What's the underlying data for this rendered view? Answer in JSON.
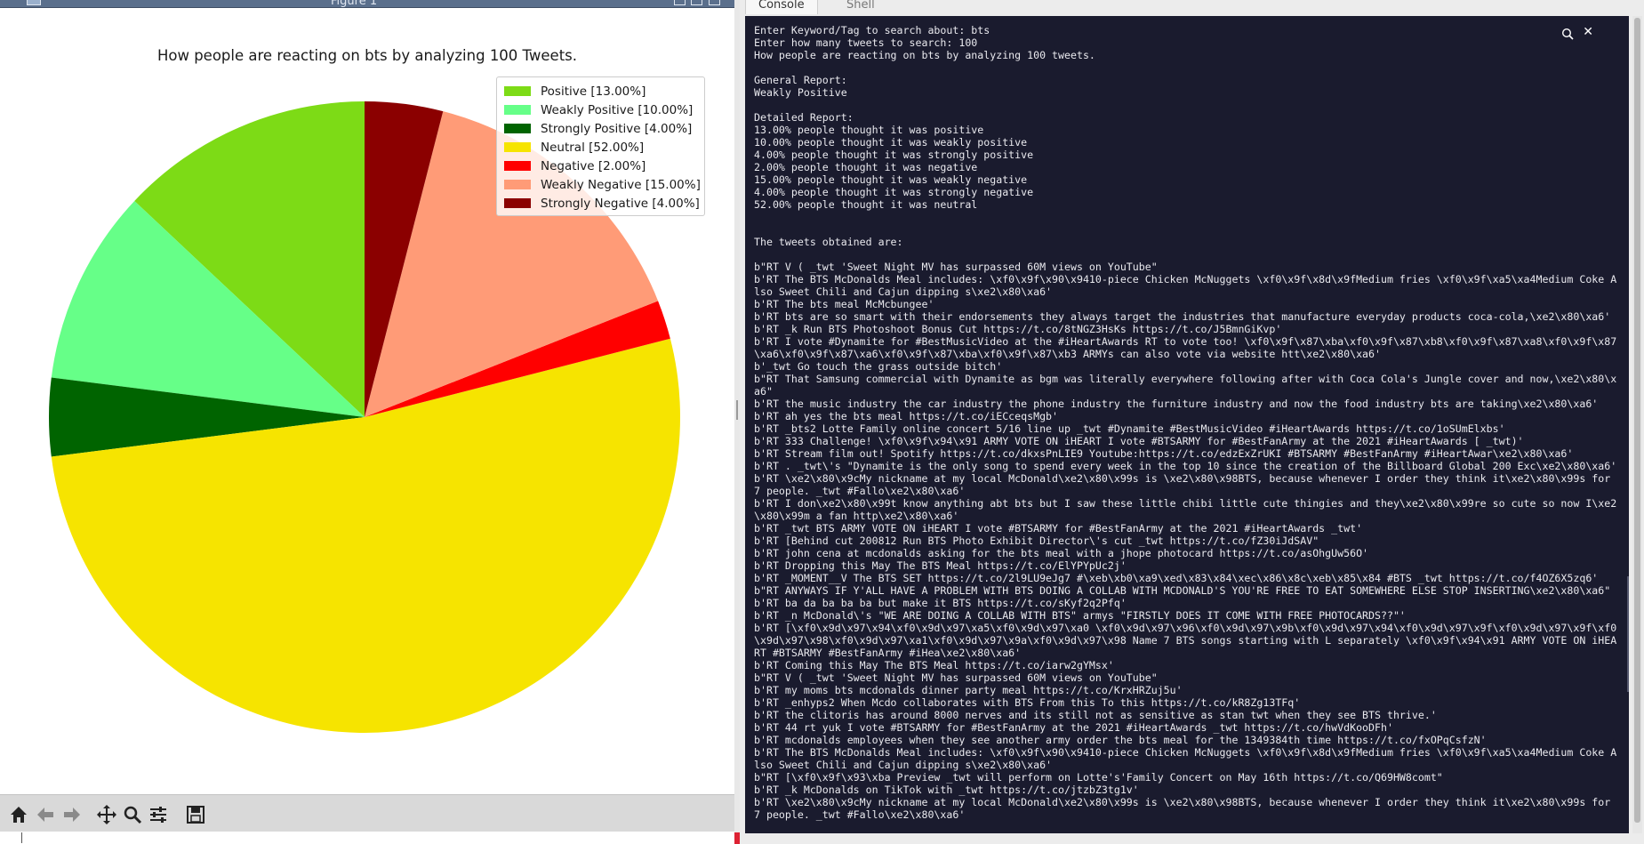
{
  "figure_window": {
    "title": "Figure 1"
  },
  "chart_data": {
    "type": "pie",
    "title": "How people are reacting on bts by analyzing 100 Tweets.",
    "start_angle_deg": 90,
    "direction": "counterclockwise",
    "legend_position": "upper-right",
    "slices": [
      {
        "label": "Positive [13.00%]",
        "value": 13,
        "color": "#7ddb16"
      },
      {
        "label": "Weakly Positive [10.00%]",
        "value": 10,
        "color": "#66ff88"
      },
      {
        "label": "Strongly Positive [4.00%]",
        "value": 4,
        "color": "#006400"
      },
      {
        "label": "Neutral [52.00%]",
        "value": 52,
        "color": "#f6e400"
      },
      {
        "label": "Negative [2.00%]",
        "value": 2,
        "color": "#ff0000"
      },
      {
        "label": "Weakly Negative [15.00%]",
        "value": 15,
        "color": "#ff9b77"
      },
      {
        "label": "Strongly Negative [4.00%]",
        "value": 4,
        "color": "#8b0000"
      }
    ]
  },
  "toolbar": {
    "buttons": [
      "home-icon",
      "back-icon",
      "forward-icon",
      "pan-icon",
      "zoom-icon",
      "configure-subplots-icon",
      "save-icon"
    ]
  },
  "console_pane": {
    "tabs": [
      "Console",
      "Shell"
    ],
    "active_tab": "Console",
    "close_glyph": "✕",
    "lines": [
      "Enter Keyword/Tag to search about: bts",
      "Enter how many tweets to search: 100",
      "How people are reacting on bts by analyzing 100 tweets.",
      "",
      "General Report:",
      "Weakly Positive",
      "",
      "Detailed Report:",
      "13.00% people thought it was positive",
      "10.00% people thought it was weakly positive",
      "4.00% people thought it was strongly positive",
      "2.00% people thought it was negative",
      "15.00% people thought it was weakly negative",
      "4.00% people thought it was strongly negative",
      "52.00% people thought it was neutral",
      "",
      "",
      "The tweets obtained are:",
      "",
      "b\"RT V ( _twt 'Sweet Night MV has surpassed 60M views on YouTube\"",
      "b'RT The BTS McDonalds Meal includes: \\xf0\\x9f\\x90\\x9410-piece Chicken McNuggets \\xf0\\x9f\\x8d\\x9fMedium fries \\xf0\\x9f\\xa5\\xa4Medium Coke Also Sweet Chili and Cajun dipping s\\xe2\\x80\\xa6'",
      "b'RT The bts meal McMcbungee'",
      "b'RT bts are so smart with their endorsements they always target the industries that manufacture everyday products coca-cola,\\xe2\\x80\\xa6'",
      "b'RT _k Run BTS Photoshoot Bonus Cut https://t.co/8tNGZ3HsKs https://t.co/J5BmnGiKvp'",
      "b'RT I vote #Dynamite for #BestMusicVideo at the #iHeartAwards RT to vote too! \\xf0\\x9f\\x87\\xba\\xf0\\x9f\\x87\\xb8\\xf0\\x9f\\x87\\xa8\\xf0\\x9f\\x87\\xa6\\xf0\\x9f\\x87\\xa6\\xf0\\x9f\\x87\\xba\\xf0\\x9f\\x87\\xb3 ARMYs can also vote via website htt\\xe2\\x80\\xa6'",
      "b'_twt Go touch the grass outside bitch'",
      "b\"RT That Samsung commercial with Dynamite as bgm was literally everywhere following after with Coca Cola's Jungle cover and now,\\xe2\\x80\\xa6\"",
      "b'RT the music industry the car industry the phone industry the furniture industry and now the food industry bts are taking\\xe2\\x80\\xa6'",
      "b'RT ah yes the bts meal https://t.co/iECceqsMgb'",
      "b'RT _bts2 Lotte Family online concert 5/16 line up _twt #Dynamite #BestMusicVideo #iHeartAwards https://t.co/1oSUmElxbs'",
      "b'RT 333 Challenge! \\xf0\\x9f\\x94\\x91 ARMY VOTE ON iHEART I vote #BTSARMY for #BestFanArmy at the 2021 #iHeartAwards [ _twt)'",
      "b'RT Stream film out! Spotify https://t.co/dkxsPnLIE9 Youtube:https://t.co/edzExZrUKI #BTSARMY #BestFanArmy #iHeartAwar\\xe2\\x80\\xa6'",
      "b'RT . _twt\\'s \"Dynamite is the only song to spend every week in the top 10 since the creation of the Billboard Global 200 Exc\\xe2\\x80\\xa6'",
      "b'RT \\xe2\\x80\\x9cMy nickname at my local McDonald\\xe2\\x80\\x99s is \\xe2\\x80\\x98BTS, because whenever I order they think it\\xe2\\x80\\x99s for 7 people. _twt #Fallo\\xe2\\x80\\xa6'",
      "b'RT I don\\xe2\\x80\\x99t know anything abt bts but I saw these little chibi little cute thingies and they\\xe2\\x80\\x99re so cute so now I\\xe2\\x80\\x99m a fan http\\xe2\\x80\\xa6'",
      "b'RT _twt BTS ARMY VOTE ON iHEART I vote #BTSARMY for #BestFanArmy at the 2021 #iHeartAwards _twt'",
      "b'RT [Behind cut 200812 Run BTS Photo Exhibit Director\\'s cut _twt https://t.co/fZ30iJdSAV\"",
      "b'RT john cena at mcdonalds asking for the bts meal with a jhope photocard https://t.co/asOhgUw56O'",
      "b'RT Dropping this May The BTS Meal https://t.co/ElYPYpUc2j'",
      "b'RT _MOMENT__V The BTS SET https://t.co/2l9LU9eJg7 #\\xeb\\xb0\\xa9\\xed\\x83\\x84\\xec\\x86\\x8c\\xeb\\x85\\x84 #BTS _twt https://t.co/f4OZ6X5zq6'",
      "b\"RT ANYWAYS IF Y'ALL HAVE A PROBLEM WITH BTS DOING A COLLAB WITH MCDONALD'S YOU'RE FREE TO EAT SOMEWHERE ELSE STOP INSERTING\\xe2\\x80\\xa6\"",
      "b'RT ba da ba ba ba but make it BTS https://t.co/sKyf2q2Pfq'",
      "b'RT _n McDonald\\'s \"WE ARE DOING A COLLAB WITH BTS\" armys \"FIRSTLY DOES IT COME WITH FREE PHOTOCARDS??\"'",
      "b'RT [\\xf0\\x9d\\x97\\x94\\xf0\\x9d\\x97\\xa5\\xf0\\x9d\\x97\\xa0 \\xf0\\x9d\\x97\\x96\\xf0\\x9d\\x97\\x9b\\xf0\\x9d\\x97\\x94\\xf0\\x9d\\x97\\x9f\\xf0\\x9d\\x97\\x9f\\xf0\\x9d\\x97\\x98\\xf0\\x9d\\x97\\xa1\\xf0\\x9d\\x97\\x9a\\xf0\\x9d\\x97\\x98 Name 7 BTS songs starting with L separately \\xf0\\x9f\\x94\\x91 ARMY VOTE ON iHEART #BTSARMY #BestFanArmy #iHea\\xe2\\x80\\xa6'",
      "b'RT Coming this May The BTS Meal https://t.co/iarw2gYMsx'",
      "b\"RT V ( _twt 'Sweet Night MV has surpassed 60M views on YouTube\"",
      "b'RT my moms bts mcdonalds dinner party meal https://t.co/KrxHRZuj5u'",
      "b'RT _enhyps2 When Mcdo collaborates with BTS From this To this https://t.co/kR8Zg13TFq'",
      "b'RT the clitoris has around 8000 nerves and its still not as sensitive as stan twt when they see BTS thrive.'",
      "b'RT 44 rt yuk I vote #BTSARMY for #BestFanArmy at the 2021 #iHeartAwards _twt https://t.co/hwVdKooDFh'",
      "b'RT mcdonalds employees when they see another army order the bts meal for the 1349384th time https://t.co/fxOPqCsfzN'",
      "b'RT The BTS McDonalds Meal includes: \\xf0\\x9f\\x90\\x9410-piece Chicken McNuggets \\xf0\\x9f\\x8d\\x9fMedium fries \\xf0\\x9f\\xa5\\xa4Medium Coke Also Sweet Chili and Cajun dipping s\\xe2\\x80\\xa6'",
      "b\"RT [\\xf0\\x9f\\x93\\xba Preview _twt will perform on Lotte's'Family Concert on May 16th https://t.co/Q69HW8comt\"",
      "b'RT _k McDonalds on TikTok with _twt https://t.co/jtzbZ3tg1v'",
      "b'RT \\xe2\\x80\\x9cMy nickname at my local McDonald\\xe2\\x80\\x99s is \\xe2\\x80\\x98BTS, because whenever I order they think it\\xe2\\x80\\x99s for 7 people. _twt #Fallo\\xe2\\x80\\xa6'"
    ]
  }
}
